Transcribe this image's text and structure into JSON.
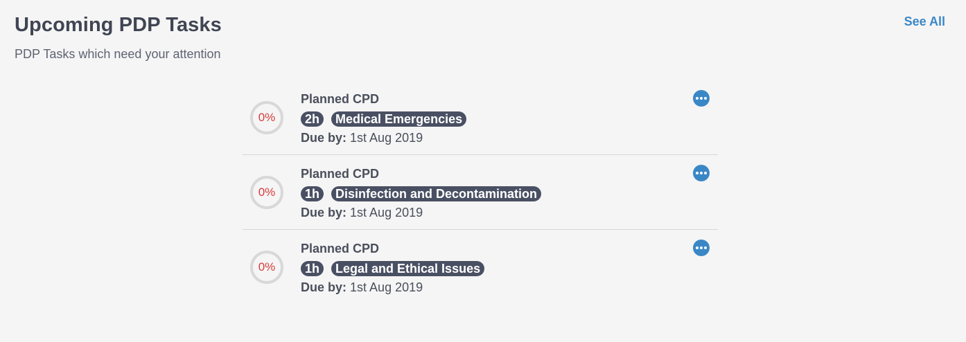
{
  "header": {
    "title": "Upcoming PDP Tasks",
    "subtitle": "PDP Tasks which need your attention",
    "see_all": "See All"
  },
  "tasks": [
    {
      "progress": "0%",
      "type": "Planned CPD",
      "hours": "2h",
      "topic": "Medical Emergencies",
      "due_label": "Due by:",
      "due_date": "1st Aug 2019"
    },
    {
      "progress": "0%",
      "type": "Planned CPD",
      "hours": "1h",
      "topic": "Disinfection and Decontamination",
      "due_label": "Due by:",
      "due_date": "1st Aug 2019"
    },
    {
      "progress": "0%",
      "type": "Planned CPD",
      "hours": "1h",
      "topic": "Legal and Ethical Issues",
      "due_label": "Due by:",
      "due_date": "1st Aug 2019"
    }
  ],
  "icons": {
    "more": "more-options-icon"
  },
  "colors": {
    "accent": "#3a87c6",
    "pill": "#4a5063",
    "progress": "#d83a3a"
  }
}
